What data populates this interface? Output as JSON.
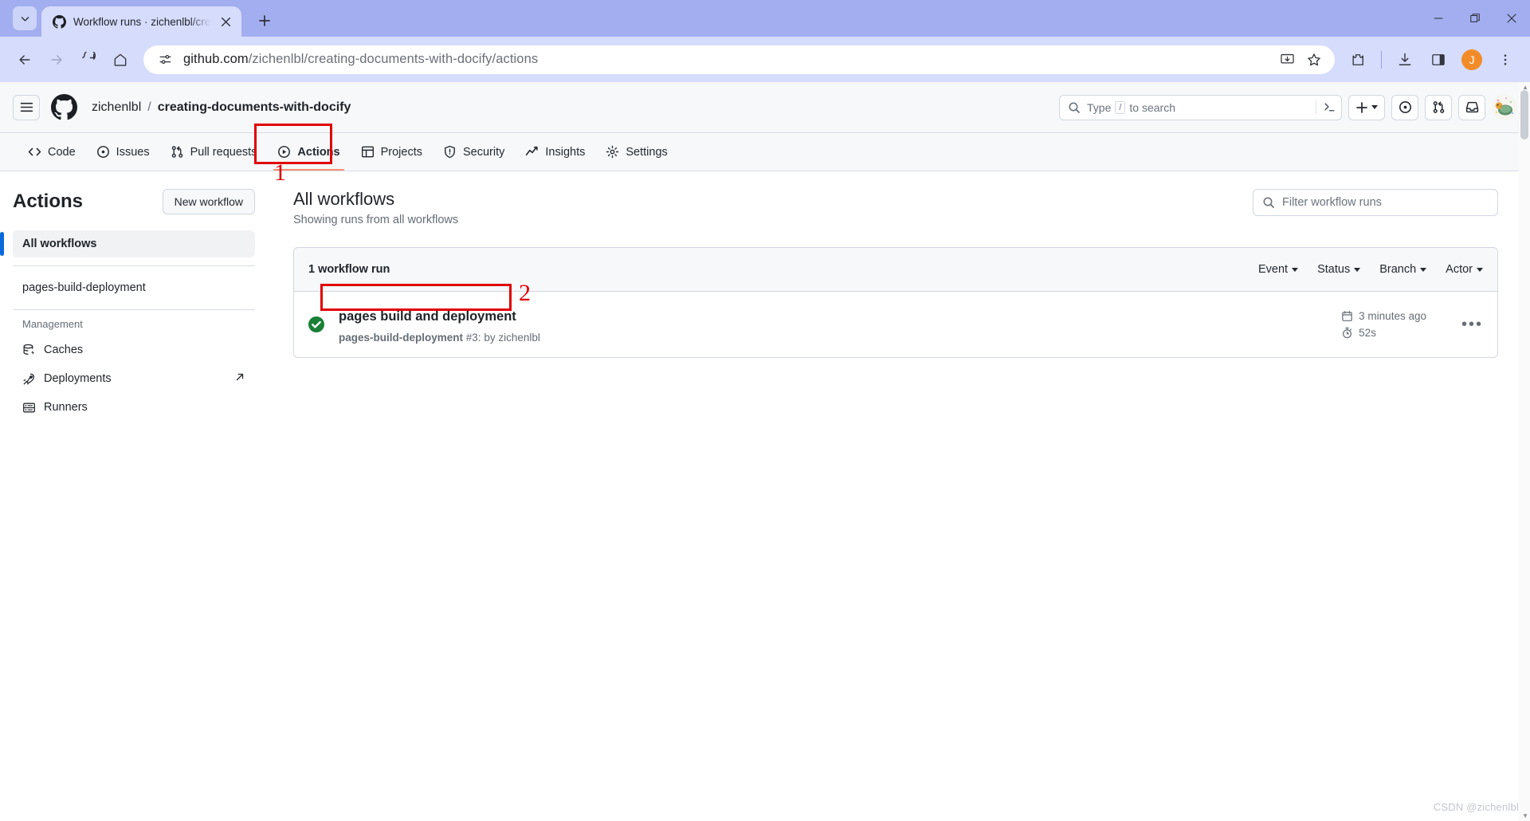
{
  "browser": {
    "tab": {
      "title": "Workflow runs · zichenlbl/cre",
      "favicon": "github-icon",
      "close": "close-icon"
    },
    "new_tab_label": "+",
    "window_controls": {
      "minimize": "minimize-icon",
      "maximize": "maximize-icon",
      "close": "close-icon"
    },
    "nav": {
      "back": "back-arrow-icon",
      "forward": "forward-arrow-icon",
      "reload": "reload-icon",
      "home": "home-icon"
    },
    "omnibox": {
      "site_settings_icon": "tune-icon",
      "url_domain": "github.com",
      "url_path": "/zichenlbl/creating-documents-with-docify/actions",
      "install_icon": "install-app-icon",
      "bookmark_icon": "star-icon"
    },
    "toolbar_right": {
      "extensions_icon": "extensions-icon",
      "downloads_icon": "download-icon",
      "side_panel_icon": "side-panel-icon",
      "profile_initial": "J",
      "menu_icon": "three-dot-menu-icon"
    }
  },
  "github": {
    "header": {
      "menu_icon": "hamburger-icon",
      "logo_icon": "github-mark-icon",
      "owner": "zichenlbl",
      "separator": "/",
      "repo": "creating-documents-with-docify",
      "search": {
        "icon": "search-icon",
        "placeholder": "Type",
        "key": "/",
        "placeholder_suffix": "to search",
        "terminal_icon": "command-palette-icon"
      },
      "create_button": {
        "icon": "plus-icon",
        "caret": "chevron-down-icon"
      },
      "issues_icon": "issue-opened-icon",
      "pulls_icon": "git-pull-request-icon",
      "inbox_icon": "inbox-icon",
      "avatar": "user-avatar"
    },
    "nav_tabs": [
      {
        "label": "Code",
        "icon": "code-icon",
        "active": false
      },
      {
        "label": "Issues",
        "icon": "issue-opened-icon",
        "active": false
      },
      {
        "label": "Pull requests",
        "icon": "git-pull-request-icon",
        "active": false
      },
      {
        "label": "Actions",
        "icon": "play-circle-icon",
        "active": true
      },
      {
        "label": "Projects",
        "icon": "table-icon",
        "active": false
      },
      {
        "label": "Security",
        "icon": "shield-icon",
        "active": false
      },
      {
        "label": "Insights",
        "icon": "graph-icon",
        "active": false
      },
      {
        "label": "Settings",
        "icon": "gear-icon",
        "active": false
      }
    ],
    "sidebar": {
      "title": "Actions",
      "new_workflow_button": "New workflow",
      "all_workflows": "All workflows",
      "workflows": [
        "pages-build-deployment"
      ],
      "management_label": "Management",
      "management_items": [
        {
          "label": "Caches",
          "icon": "cache-icon",
          "external": false
        },
        {
          "label": "Deployments",
          "icon": "rocket-icon",
          "external": true
        },
        {
          "label": "Runners",
          "icon": "server-icon",
          "external": false
        }
      ]
    },
    "main": {
      "title": "All workflows",
      "subtitle": "Showing runs from all workflows",
      "filter_placeholder": "Filter workflow runs",
      "runs_count": "1 workflow run",
      "filters": [
        "Event",
        "Status",
        "Branch",
        "Actor"
      ],
      "runs": [
        {
          "status": "success",
          "title": "pages build and deployment",
          "workflow_name": "pages-build-deployment",
          "run_number": "#3:",
          "by": "by zichenlbl",
          "relative_time": "3 minutes ago",
          "duration": "52s",
          "menu": "kebab-menu-icon"
        }
      ]
    }
  },
  "annotations": [
    {
      "number": "1",
      "target": "actions-tab"
    },
    {
      "number": "2",
      "target": "workflow-run-title"
    }
  ],
  "watermark": "CSDN @zichenlbl",
  "colors": {
    "accent_blue": "#0969da",
    "success_green": "#1a7f37",
    "active_underline": "#fd8c73",
    "annotation_red": "#e00000",
    "chrome_tabstrip": "#a3aef0",
    "chrome_toolbar": "#d6dcfb"
  }
}
